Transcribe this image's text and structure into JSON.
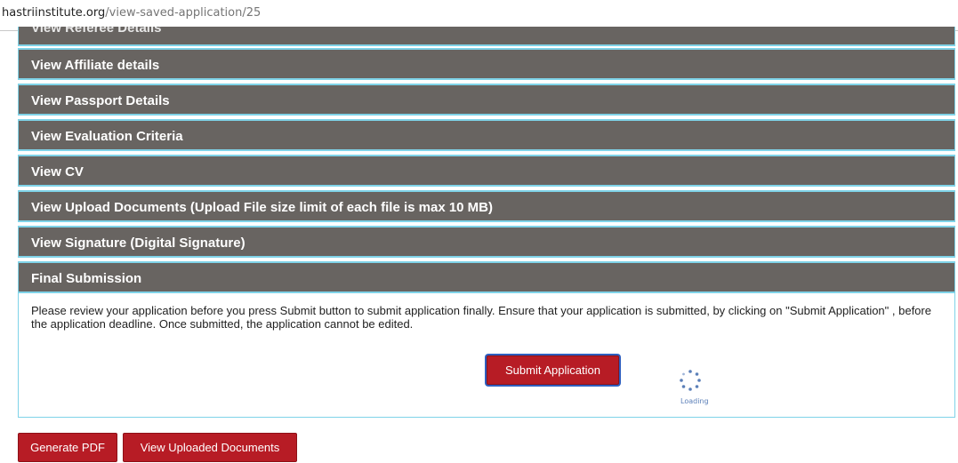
{
  "url_bar": {
    "domain": "hastriinstitute.org",
    "path": "/view-saved-application/25"
  },
  "sections": [
    {
      "label": "View Referee Details"
    },
    {
      "label": "View Affiliate details"
    },
    {
      "label": "View Passport Details"
    },
    {
      "label": "View Evaluation Criteria"
    },
    {
      "label": "View CV"
    },
    {
      "label": "View Upload Documents (Upload File size limit of each file is max 10 MB)"
    },
    {
      "label": "View Signature (Digital Signature)"
    },
    {
      "label": "Final Submission"
    }
  ],
  "final_submission": {
    "notice": "Please review your application before you press Submit button to submit application finally. Ensure that your application is submitted, by clicking on \"Submit Application\" , before the application deadline. Once submitted, the application cannot be edited.",
    "submit_label": "Submit Application",
    "loading_label": "Loading"
  },
  "footer_buttons": {
    "generate_pdf": "Generate PDF",
    "view_uploaded": "View Uploaded Documents"
  },
  "colors": {
    "header_bar": "#686461",
    "header_border": "#7fd3e8",
    "button_red": "#b71c25",
    "spinner": "#5b7fb8"
  }
}
